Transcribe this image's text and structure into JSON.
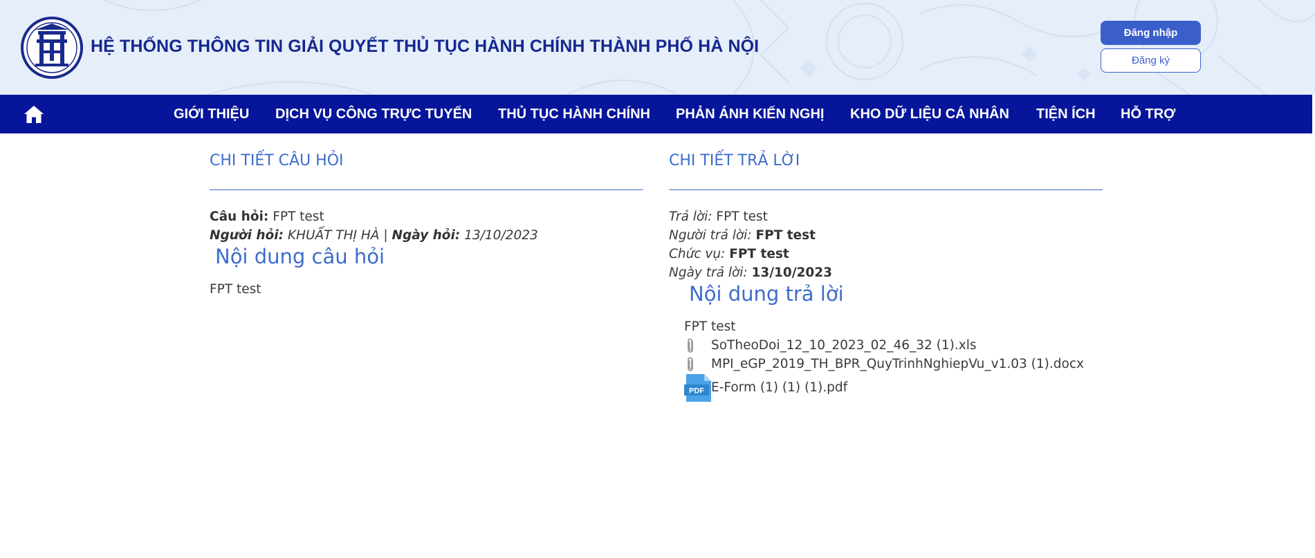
{
  "header": {
    "site_title": "HỆ THỐNG THÔNG TIN GIẢI QUYẾT THỦ TỤC HÀNH CHÍNH THÀNH PHỐ HÀ NỘI",
    "login_label": "Đăng nhập",
    "register_label": "Đăng ký"
  },
  "nav": {
    "items": [
      "GIỚI THIỆU",
      "DỊCH VỤ CÔNG TRỰC TUYẾN",
      "THỦ TỤC HÀNH CHÍNH",
      "PHẢN ÁNH KIẾN NGHỊ",
      "KHO DỮ LIỆU CÁ NHÂN",
      "TIỆN ÍCH",
      "HỖ TRỢ"
    ]
  },
  "question": {
    "section_title": "CHI TIẾT CÂU HỎI",
    "question_label": "Câu hỏi:",
    "question_value": "FPT test",
    "asker_label": "Người hỏi:",
    "asker_value": "KHUẤT THỊ HÀ",
    "separator": "|",
    "date_label": "Ngày hỏi:",
    "date_value": "13/10/2023",
    "content_heading": "Nội dung câu hỏi",
    "content_text": "FPT test"
  },
  "answer": {
    "section_title": "CHI TIẾT TRẢ LỜI",
    "answer_label": "Trả lời:",
    "answer_value": "FPT test",
    "responder_label": "Người trả lời:",
    "responder_value": "FPT test",
    "position_label": "Chức vụ:",
    "position_value": "FPT test",
    "date_label": "Ngày trả lời:",
    "date_value": "13/10/2023",
    "content_heading": "Nội dung trả lời",
    "content_text": "FPT test",
    "attachments": [
      {
        "name": "SoTheoDoi_12_10_2023_02_46_32 (1).xls",
        "icon": "paperclip-icon"
      },
      {
        "name": "MPI_eGP_2019_TH_BPR_QuyTrinhNghiepVu_v1.03 (1).docx",
        "icon": "paperclip-icon"
      },
      {
        "name": "E-Form (1) (1) (1).pdf",
        "icon": "pdf-file-icon",
        "icon_text": "PDF"
      }
    ]
  },
  "colors": {
    "nav_background": "#07159a",
    "title_blue": "#15288f",
    "accent_blue": "#3d6ccc",
    "login_button": "#3a5fcb",
    "header_background": "#e6eef9"
  }
}
